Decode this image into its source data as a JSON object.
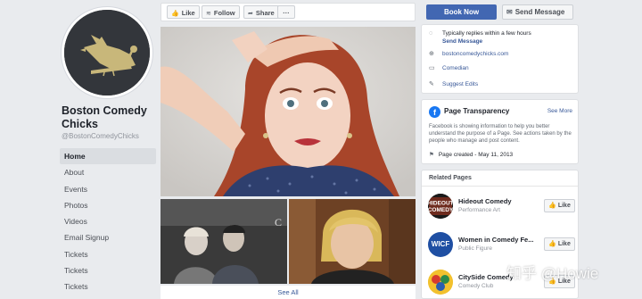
{
  "profile": {
    "name": "Boston Comedy Chicks",
    "handle": "@BostonComedyChicks"
  },
  "nav": [
    {
      "label": "Home",
      "active": true
    },
    {
      "label": "About"
    },
    {
      "label": "Events"
    },
    {
      "label": "Photos"
    },
    {
      "label": "Videos"
    },
    {
      "label": "Email Signup"
    },
    {
      "label": "Tickets"
    },
    {
      "label": "Tickets"
    },
    {
      "label": "Tickets"
    }
  ],
  "toolbar": {
    "like_label": "Like",
    "follow_label": "Follow",
    "share_label": "Share",
    "more_label": "···"
  },
  "media": {
    "see_all_label": "See All"
  },
  "actions": {
    "book_label": "Book Now",
    "send_label": "Send Message"
  },
  "about": {
    "response_text": "Typically replies within a few hours",
    "response_link": "Send Message",
    "website": "bostoncomedychicks.com",
    "category": "Comedian",
    "suggest_edits": "Suggest Edits"
  },
  "transparency": {
    "title": "Page Transparency",
    "see_more": "See More",
    "description": "Facebook is showing information to help you better understand the purpose of a Page. See actions taken by the people who manage and post content.",
    "created": "Page created - May 11, 2013"
  },
  "related": {
    "title": "Related Pages",
    "items": [
      {
        "name": "Hideout Comedy",
        "category": "Performance Art",
        "like_label": "Like",
        "logo_text": "HIDEOUT COMEDY",
        "logo_color": "#1a1a1a"
      },
      {
        "name": "Women in Comedy Fe...",
        "category": "Public Figure",
        "like_label": "Like",
        "logo_text": "WICF",
        "logo_color": "#1f4fa3"
      },
      {
        "name": "CitySide Comedy",
        "category": "Comedy Club",
        "like_label": "Like",
        "logo_text": "",
        "logo_color": "#d63b2f"
      }
    ]
  },
  "watermark": {
    "text": "知乎 @Howie"
  },
  "colors": {
    "accent": "#4267b2",
    "link": "#385898",
    "background": "#e9ebee"
  }
}
